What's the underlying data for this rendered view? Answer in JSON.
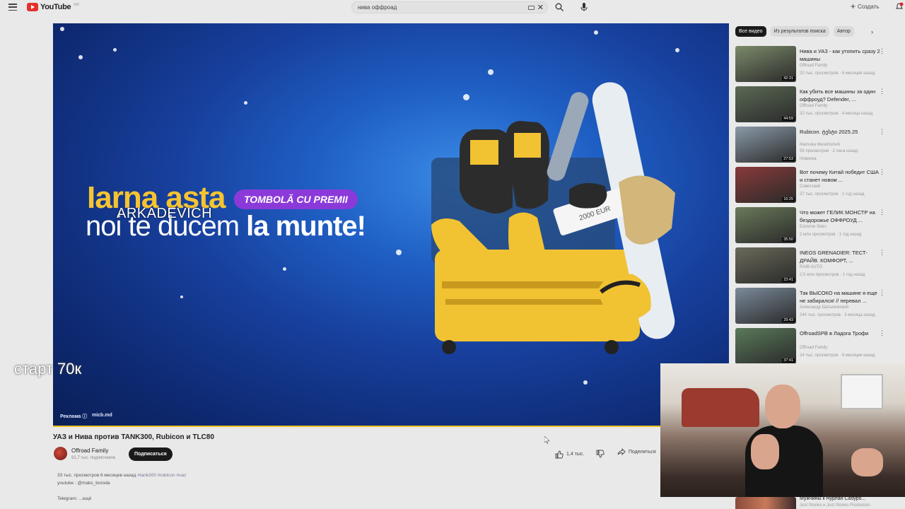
{
  "app": {
    "logo_text": "YouTube",
    "logo_sup": "MD"
  },
  "search": {
    "value": "нива оффроад"
  },
  "header": {
    "create_label": "Создать"
  },
  "ad": {
    "line1": "Iarna asta",
    "pill": "TOMBOLĂ CU PREMII",
    "line2_light": "noi te ducem ",
    "line2_bold": "la munte!",
    "badge": "Реклама ⓘ",
    "domain": "micb.md",
    "ticket": "2000 EUR"
  },
  "overlay": {
    "name": "ARKADEVICH",
    "goal": "старт 70к"
  },
  "video": {
    "title": "УАЗ и Нива против TANK300, Rubicon и TLC80",
    "channel": "Offroad Family",
    "subs": "92,7 тыс. подписчиков",
    "subscribe_label": "Подписаться",
    "likes": "1,4 тыс.",
    "share_label": "Поделиться",
    "meta": "33 тыс. просмотров  6 месяцев назад",
    "tags": "#tank300 #rubicon #uaz",
    "desc_link": "youtube : @maks_boroda",
    "more": "Telegram: ...ещё"
  },
  "chips": [
    "Все видео",
    "Из результатов поиска",
    "Автор"
  ],
  "recs": [
    {
      "title": "Нива и УАЗ - как утопить сразу 2 машины",
      "channel": "Offroad Family",
      "meta": "20 тыс. просмотров · 6 месяцев назад",
      "duration": "42:31",
      "color": "#7b8a6a"
    },
    {
      "title": "Как убить все машины за один оффроуд? Defender, ...",
      "channel": "Offroad Family",
      "meta": "32 тыс. просмотров · 4 месяца назад",
      "duration": "44:59",
      "color": "#5b6a55"
    },
    {
      "title": "Rubicon. ტესტი 2025.25",
      "channel": "Mamuka Meskhishvili",
      "meta": "59 просмотров · 2 часа назад",
      "extra": "Новинка",
      "duration": "27:53",
      "color": "#8a9aa8"
    },
    {
      "title": "Вот почему Китай победит США и станет новом ...",
      "channel": "Советский",
      "meta": "27 тыс. просмотров · 1 год назад",
      "duration": "16:25",
      "color": "#8a3a3a"
    },
    {
      "title": "Что может ГЕЛИК МОНСТР на бездорожье ОФФРОУД ...",
      "channel": "Extreme Stars",
      "meta": "2 млн просмотров · 1 год назад",
      "duration": "35:50",
      "color": "#6a7a5a"
    },
    {
      "title": "INEOS GRENADIER: ТЕСТ-ДРАЙВ. КОМФОРТ, ...",
      "channel": "RAIB AUTO",
      "meta": "2,5 млн просмотров · 1 год назад",
      "duration": "23:41",
      "color": "#6a6a5a"
    },
    {
      "title": "Так ВЫСОКО на машине я еще не забирался! // перевал ...",
      "channel": "Александр Шатыковский",
      "meta": "240 тыс. просмотров · 3 месяца назад",
      "duration": "29:43",
      "color": "#7a8a9a"
    },
    {
      "title": "OffroadSPB в Ладога Трофи",
      "channel": "Offroad Family",
      "meta": "24 тыс. просмотров · 6 месяцев назад",
      "duration": "37:41",
      "color": "#5a7a5a"
    }
  ],
  "partial_rec": {
    "title": "Мужчины к Нурлан Сабуро...",
    "channel": "Just Stories и Just Stories Production"
  }
}
